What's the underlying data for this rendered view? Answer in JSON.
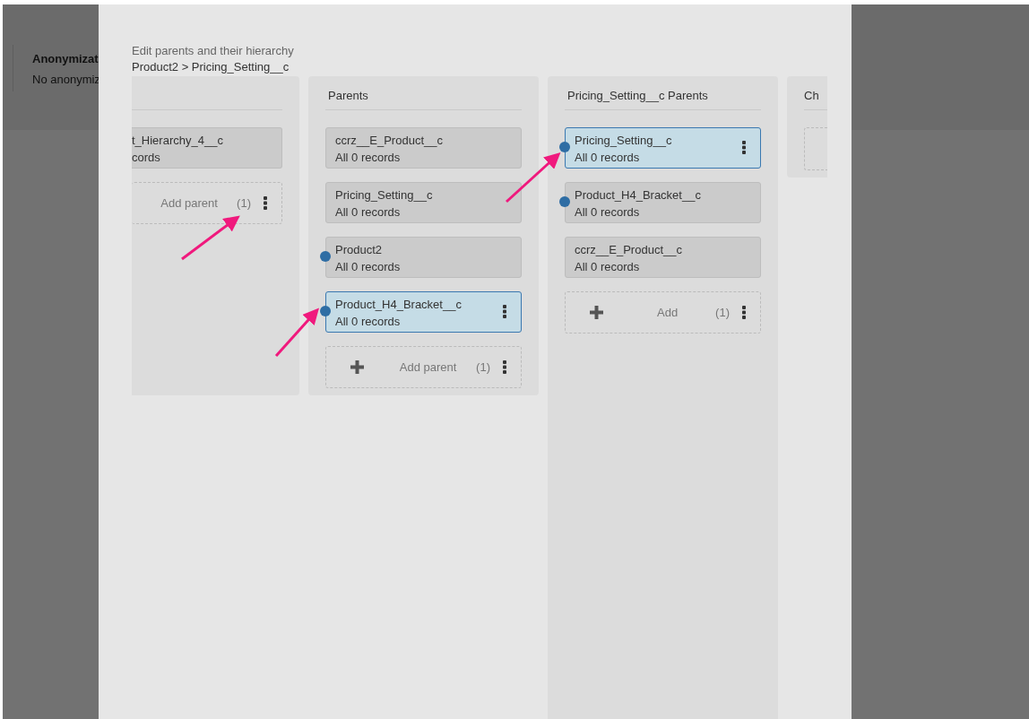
{
  "background": {
    "title": "Anonymizat",
    "text": "No anonymiz"
  },
  "dialog": {
    "subtitle": "Edit parents and their hierarchy",
    "breadcrumb": "Product2 > Pricing_Setting__c",
    "columns": [
      {
        "kind": "cut-left",
        "cards": [
          {
            "name": "t_Hierarchy_4__c",
            "records": "cords",
            "dot": false,
            "selected": false
          }
        ],
        "add": {
          "label": "Add parent",
          "count": "(1)"
        }
      },
      {
        "kind": "full",
        "title": "Parents",
        "cards": [
          {
            "name": "ccrz__E_Product__c",
            "records": "All 0 records",
            "dot": false,
            "selected": false
          },
          {
            "name": "Pricing_Setting__c",
            "records": "All 0 records",
            "dot": false,
            "selected": false
          },
          {
            "name": "Product2",
            "records": "All 0 records",
            "dot": true,
            "selected": false
          },
          {
            "name": "Product_H4_Bracket__c",
            "records": "All 0 records",
            "dot": true,
            "selected": true
          }
        ],
        "add": {
          "label": "Add parent",
          "count": "(1)"
        }
      },
      {
        "kind": "tall",
        "title": "Pricing_Setting__c Parents",
        "cards": [
          {
            "name": "Pricing_Setting__c",
            "records": "All 0 records",
            "dot": true,
            "selected": true
          },
          {
            "name": "Product_H4_Bracket__c",
            "records": "All 0 records",
            "dot": true,
            "selected": false
          },
          {
            "name": "ccrz__E_Product__c",
            "records": "All 0 records",
            "dot": false,
            "selected": false
          }
        ],
        "add": {
          "label": "Add",
          "count": "(1)"
        }
      },
      {
        "kind": "cut-right",
        "title": "Ch"
      }
    ]
  }
}
